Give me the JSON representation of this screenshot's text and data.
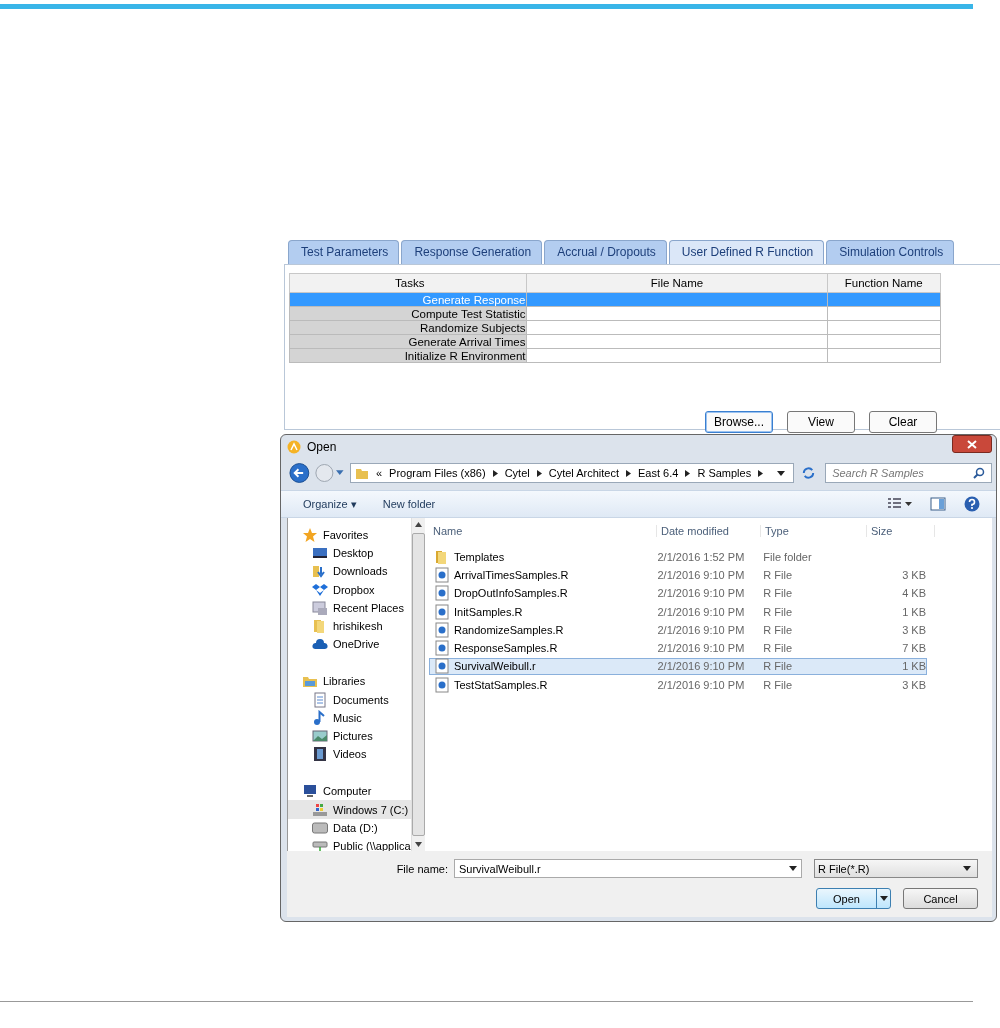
{
  "tabs": [
    {
      "label": "Test Parameters",
      "selected": false
    },
    {
      "label": "Response Generation",
      "selected": false
    },
    {
      "label": "Accrual / Dropouts",
      "selected": false
    },
    {
      "label": "User Defined R Function",
      "selected": true
    },
    {
      "label": "Simulation Controls",
      "selected": false
    }
  ],
  "tasks_table": {
    "columns": [
      "Tasks",
      "File Name",
      "Function Name"
    ],
    "rows": [
      {
        "task": "Generate Response",
        "selected": true
      },
      {
        "task": "Compute Test Statistic",
        "selected": false
      },
      {
        "task": "Randomize Subjects",
        "selected": false
      },
      {
        "task": "Generate Arrival Times",
        "selected": false
      },
      {
        "task": "Initialize R Environment",
        "selected": false
      }
    ]
  },
  "panel_buttons": [
    {
      "label": "Browse...",
      "focused": true
    },
    {
      "label": "View",
      "focused": false
    },
    {
      "label": "Clear",
      "focused": false
    }
  ],
  "dialog": {
    "title": "Open",
    "breadcrumb": [
      "«",
      "Program Files (x86)",
      "Cytel",
      "Cytel Architect",
      "East 6.4",
      "R Samples"
    ],
    "search": {
      "placeholder": "Search R Samples"
    },
    "toolbar": {
      "organize": "Organize ▾",
      "new_folder": "New folder"
    },
    "nav": [
      {
        "label": "Favorites",
        "kind": "star",
        "selected": false,
        "children": [
          {
            "label": "Desktop",
            "kind": "desktop",
            "selected": false
          },
          {
            "label": "Downloads",
            "kind": "downloads",
            "selected": false
          },
          {
            "label": "Dropbox",
            "kind": "dropbox",
            "selected": false
          },
          {
            "label": "Recent Places",
            "kind": "recent",
            "selected": false
          },
          {
            "label": "hrishikesh",
            "kind": "folder",
            "selected": false
          },
          {
            "label": "OneDrive",
            "kind": "cloud",
            "selected": false
          }
        ]
      },
      {
        "label": "Libraries",
        "kind": "library",
        "selected": false,
        "children": [
          {
            "label": "Documents",
            "kind": "document",
            "selected": false
          },
          {
            "label": "Music",
            "kind": "music",
            "selected": false
          },
          {
            "label": "Pictures",
            "kind": "pictures",
            "selected": false
          },
          {
            "label": "Videos",
            "kind": "video",
            "selected": false
          }
        ]
      },
      {
        "label": "Computer",
        "kind": "computer",
        "selected": false,
        "children": [
          {
            "label": "Windows 7 (C:)",
            "kind": "windrive",
            "selected": true
          },
          {
            "label": "Data (D:)",
            "kind": "drive",
            "selected": false
          },
          {
            "label": "Public (\\\\applica",
            "kind": "network",
            "selected": false
          }
        ]
      }
    ],
    "columns": [
      "Name",
      "Date modified",
      "Type",
      "Size"
    ],
    "files": [
      {
        "name": "Templates",
        "date": "2/1/2016 1:52 PM",
        "type": "File folder",
        "kind": "folder",
        "selected": false
      },
      {
        "name": "ArrivalTimesSamples.R",
        "date": "2/1/2016 9:10 PM",
        "type": "R File",
        "size": "3 KB",
        "kind": "file",
        "selected": false
      },
      {
        "name": "DropOutInfoSamples.R",
        "date": "2/1/2016 9:10 PM",
        "type": "R File",
        "size": "4 KB",
        "kind": "file",
        "selected": false
      },
      {
        "name": "InitSamples.R",
        "date": "2/1/2016 9:10 PM",
        "type": "R File",
        "size": "1 KB",
        "kind": "file",
        "selected": false
      },
      {
        "name": "RandomizeSamples.R",
        "date": "2/1/2016 9:10 PM",
        "type": "R File",
        "size": "3 KB",
        "kind": "file",
        "selected": false
      },
      {
        "name": "ResponseSamples.R",
        "date": "2/1/2016 9:10 PM",
        "type": "R File",
        "size": "7 KB",
        "kind": "file",
        "selected": false
      },
      {
        "name": "SurvivalWeibull.r",
        "date": "2/1/2016 9:10 PM",
        "type": "R File",
        "size": "1 KB",
        "kind": "file",
        "selected": true
      },
      {
        "name": "TestStatSamples.R",
        "date": "2/1/2016 9:10 PM",
        "type": "R File",
        "size": "3 KB",
        "kind": "file",
        "selected": false
      }
    ],
    "file_name_label": "File name:",
    "file_name": "SurvivalWeibull.r",
    "file_type": "R File(*.R)",
    "buttons": [
      "Open",
      "Cancel"
    ]
  }
}
